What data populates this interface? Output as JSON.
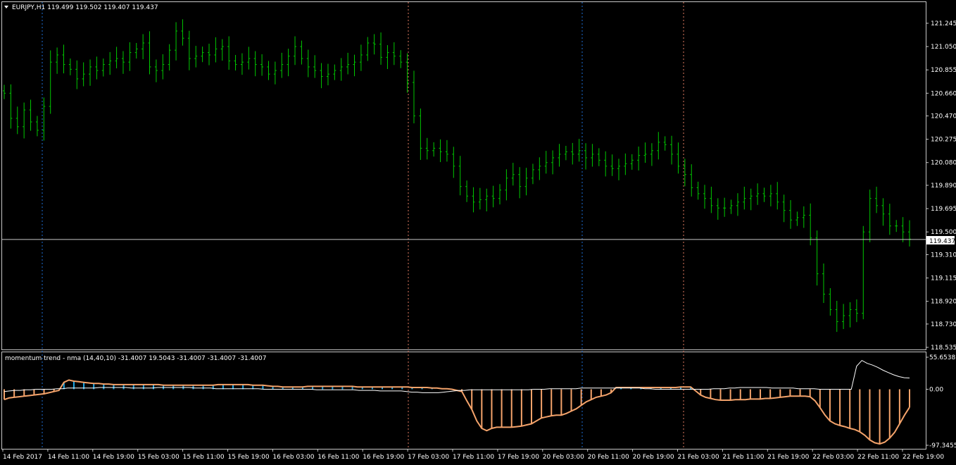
{
  "main_window": {
    "symbol_header": "EURJPY,H1  119.499 119.502 119.407 119.437",
    "price_axis_ticks": [
      "121.245",
      "121.050",
      "120.855",
      "120.660",
      "120.470",
      "120.275",
      "120.080",
      "119.890",
      "119.695",
      "119.500",
      "119.310",
      "119.115",
      "118.920",
      "118.730",
      "118.535"
    ],
    "current_price_label": "119.437",
    "current_price": 119.437,
    "price_range": [
      118.5,
      121.4
    ]
  },
  "indicator_window": {
    "header": "momentum trend - nma (14,40,10) -31.4007 19.5043 -31.4007 -31.4007 -31.4007",
    "axis_ticks": [
      "55.6538",
      "0.00",
      "-97.3455"
    ],
    "value_range": [
      -97.3455,
      55.6538
    ]
  },
  "time_axis": {
    "labels": [
      "14 Feb 2017",
      "14 Feb 11:00",
      "14 Feb 19:00",
      "15 Feb 03:00",
      "15 Feb 11:00",
      "15 Feb 19:00",
      "16 Feb 03:00",
      "16 Feb 11:00",
      "16 Feb 19:00",
      "17 Feb 03:00",
      "17 Feb 11:00",
      "17 Feb 19:00",
      "20 Feb 03:00",
      "20 Feb 11:00",
      "20 Feb 19:00",
      "21 Feb 03:00",
      "21 Feb 11:00",
      "21 Feb 19:00",
      "22 Feb 03:00",
      "22 Feb 11:00",
      "22 Feb 19:00"
    ]
  },
  "colors": {
    "background": "#000000",
    "bars": "#00c800",
    "frame": "#c8c8c8",
    "hist_positive": "#1ea9e6",
    "hist_negative": "#f4a36b",
    "signal_line": "#ffffff",
    "day_separator_blue": "#1e6fd9",
    "day_separator_orange": "#e07a5f"
  },
  "chart_data": [
    {
      "type": "ohlc",
      "title": "EURJPY,H1",
      "bars_close": [
        120.66,
        120.45,
        120.38,
        120.52,
        120.42,
        120.35,
        120.55,
        120.92,
        120.98,
        120.9,
        120.86,
        120.78,
        120.82,
        120.88,
        120.85,
        120.9,
        120.93,
        120.95,
        120.92,
        121.0,
        121.03,
        121.08,
        120.88,
        120.85,
        120.9,
        121.02,
        121.18,
        121.12,
        120.95,
        120.97,
        121.0,
        120.98,
        121.03,
        121.05,
        120.93,
        120.9,
        120.92,
        120.95,
        120.9,
        120.88,
        120.82,
        120.85,
        120.9,
        120.97,
        121.05,
        120.95,
        120.88,
        120.85,
        120.8,
        120.82,
        120.85,
        120.88,
        120.9,
        120.92,
        120.98,
        121.08,
        121.07,
        120.96,
        121.0,
        120.97,
        120.92,
        120.75,
        120.47,
        120.2,
        120.18,
        120.2,
        120.17,
        120.15,
        120.05,
        119.88,
        119.8,
        119.75,
        119.77,
        119.8,
        119.78,
        119.85,
        119.95,
        119.98,
        119.88,
        119.95,
        120.02,
        120.05,
        120.08,
        120.12,
        120.15,
        120.17,
        120.15,
        120.18,
        120.12,
        120.15,
        120.1,
        120.05,
        120.03,
        120.05,
        120.07,
        120.1,
        120.14,
        120.15,
        120.18,
        120.25,
        120.23,
        120.15,
        120.05,
        119.98,
        119.87,
        119.82,
        119.78,
        119.72,
        119.7,
        119.7,
        119.72,
        119.75,
        119.78,
        119.8,
        119.82,
        119.8,
        119.82,
        119.75,
        119.68,
        119.6,
        119.62,
        119.64,
        119.45,
        119.15,
        118.98,
        118.85,
        118.75,
        118.8,
        118.85,
        118.82,
        119.5,
        119.78,
        119.72,
        119.65,
        119.55,
        119.55,
        119.5,
        119.44
      ],
      "y_axis_ticks": [
        121.245,
        121.05,
        120.855,
        120.66,
        120.47,
        120.275,
        120.08,
        119.89,
        119.695,
        119.5,
        119.31,
        119.115,
        118.92,
        118.73,
        118.535
      ]
    },
    {
      "type": "histogram",
      "title": "momentum trend - nma (14,40,10)",
      "ylim": [
        -97.3455,
        55.6538
      ],
      "series": [
        {
          "values": [
            -18,
            -15,
            -14,
            -13,
            -12,
            -11,
            -10,
            -9,
            -8,
            -6,
            -4,
            -2,
            12,
            16,
            14,
            13,
            12,
            11,
            10,
            10,
            9,
            9,
            8,
            8,
            8,
            8,
            8,
            8,
            8,
            8,
            8,
            8,
            7,
            7,
            7,
            7,
            7,
            7,
            7,
            7,
            7,
            7,
            7,
            8,
            8,
            8,
            8,
            8,
            8,
            8,
            7,
            7,
            7,
            6,
            5,
            5,
            4,
            4,
            4,
            4,
            4,
            5,
            5,
            5,
            5,
            5,
            5,
            5,
            5,
            5,
            5,
            4,
            4,
            4,
            4,
            4,
            4,
            4,
            4,
            4,
            4,
            4,
            3,
            3,
            3,
            3,
            2,
            2,
            1,
            1,
            0,
            -2,
            -4,
            -20,
            -35,
            -55,
            -68,
            -72,
            -68,
            -66,
            -66,
            -66,
            -66,
            -65,
            -64,
            -62,
            -60,
            -55,
            -50,
            -48,
            -46,
            -45,
            -45,
            -42,
            -38,
            -34,
            -28,
            -22,
            -18,
            -14,
            -12,
            -10,
            -6,
            3,
            3,
            3,
            3,
            3,
            3,
            3,
            3,
            3,
            3,
            3,
            3,
            3,
            4,
            4,
            4,
            -3,
            -10,
            -14,
            -16,
            -18,
            -19,
            -19,
            -19,
            -18,
            -18,
            -18,
            -17,
            -17,
            -17,
            -16,
            -16,
            -15,
            -14,
            -13,
            -12,
            -12,
            -12,
            -12,
            -13,
            -20,
            -32,
            -45,
            -55,
            -60,
            -63,
            -65,
            -68,
            -70,
            -74,
            -80,
            -88,
            -93,
            -95,
            -92,
            -85,
            -75,
            -60,
            -45,
            -31.4
          ]
        },
        {
          "values": [
            -4,
            -3,
            -2,
            -2,
            -1,
            -1,
            0,
            0,
            0,
            0,
            1,
            1,
            2,
            2,
            2,
            2,
            2,
            2,
            3,
            3,
            3,
            3,
            3,
            3,
            2,
            2,
            2,
            2,
            2,
            3,
            3,
            3,
            3,
            3,
            3,
            3,
            2,
            2,
            2,
            2,
            1,
            1,
            1,
            1,
            1,
            1,
            1,
            1,
            1,
            0,
            0,
            0,
            0,
            0,
            0,
            0,
            0,
            0,
            0,
            -1,
            -1,
            -1,
            -1,
            -1,
            -1,
            -1,
            -1,
            -2,
            -2,
            -2,
            -2,
            -3,
            -3,
            -3,
            -3,
            -3,
            -4,
            -5,
            -5,
            -6,
            -6,
            -6,
            -6,
            -5,
            -4,
            -3,
            -2,
            -2,
            -1,
            -1,
            -1,
            -1,
            -1,
            -1,
            -1,
            -1,
            -1,
            -1,
            -1,
            -1,
            0,
            0,
            0,
            1,
            1,
            1,
            1,
            1,
            1,
            2,
            2,
            2,
            2,
            2,
            2,
            2,
            2,
            2,
            2,
            2,
            2,
            1,
            1,
            0,
            0,
            0,
            0,
            0,
            0,
            0,
            0,
            0,
            0,
            0,
            1,
            1,
            1,
            2,
            2,
            3,
            3,
            3,
            3,
            3,
            3,
            2,
            2,
            2,
            2,
            2,
            1,
            1,
            1,
            1,
            0,
            0,
            0,
            0,
            0,
            0,
            0,
            40,
            50,
            45,
            42,
            38,
            33,
            29,
            25,
            22,
            20,
            19.5
          ]
        }
      ]
    }
  ]
}
